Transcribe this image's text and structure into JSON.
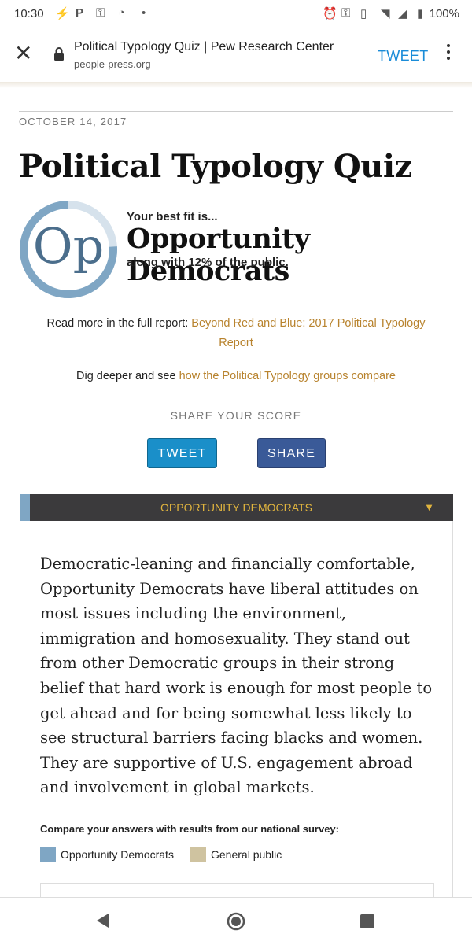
{
  "status_bar": {
    "time": "10:30",
    "battery": "100%"
  },
  "browser": {
    "page_title": "Political Typology Quiz | Pew Research Center",
    "domain": "people-press.org",
    "tweet_label": "TWEET"
  },
  "article": {
    "date": "OCTOBER 14, 2017",
    "title": "Political Typology Quiz",
    "result": {
      "abbr": "Op",
      "best_fit": "Your best fit is...",
      "group_name": "Opportunity Democrats",
      "share_text": "along with 12% of the public.",
      "share_of_public": 0.12
    },
    "read_more": {
      "prefix": "Read more in the full report: ",
      "link": "Beyond Red and Blue: 2017 Political Typology Report"
    },
    "dig_deeper": {
      "prefix": "Dig deeper and see ",
      "link": "how the Political Typology groups compare"
    },
    "share": {
      "heading": "SHARE YOUR SCORE",
      "tweet": "TWEET",
      "share": "SHARE"
    },
    "panel": {
      "header": "OPPORTUNITY DEMOCRATS",
      "arrow": "▼",
      "description": "Democratic-leaning and financially comfortable, Opportunity Democrats have liberal attitudes on most issues including the environment, immigration and homosexuality. They stand out from other Democratic groups in their strong belief that hard work is enough for most people to get ahead and for being somewhat less likely to see structural barriers facing blacks and women. They are supportive of U.S. engagement abroad and involvement in global markets.",
      "compare": "Compare your answers with results from our national survey:",
      "legend": [
        {
          "label": "Opportunity Democrats",
          "color": "#7fa6c4"
        },
        {
          "label": "General public",
          "color": "#cfc3a0"
        }
      ]
    }
  },
  "colors": {
    "accent_link": "#b8832e",
    "tweet_blue": "#1a8fc9",
    "share_blue": "#3a5a98",
    "panel_dark": "#3b3a3c",
    "panel_gold": "#e0b43e",
    "ring_blue": "#7fa6c4"
  }
}
